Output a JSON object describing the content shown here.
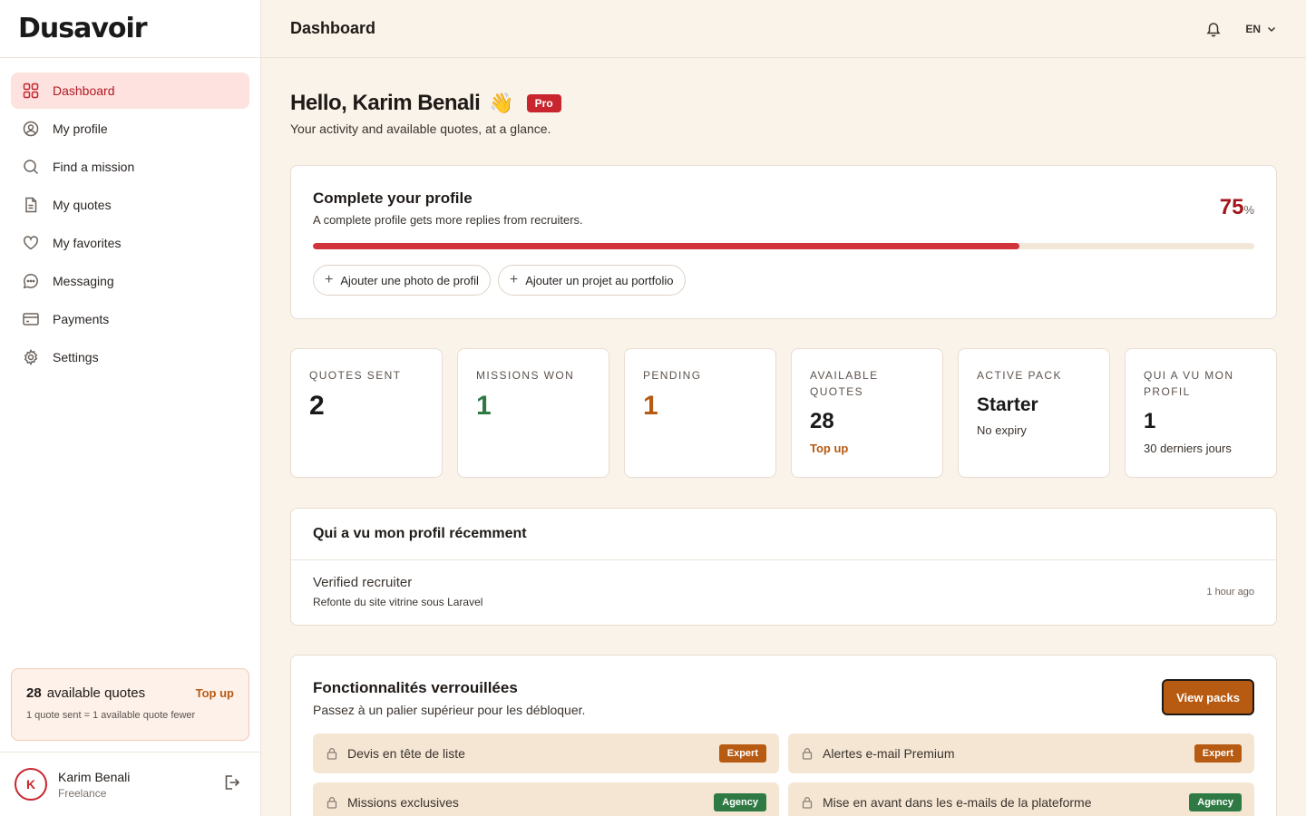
{
  "brand": {
    "logo": "Dusavoir"
  },
  "sidebar": {
    "items": [
      {
        "label": "Dashboard",
        "icon": "grid-icon",
        "active": true
      },
      {
        "label": "My profile",
        "icon": "user-circle-icon"
      },
      {
        "label": "Find a mission",
        "icon": "search-icon"
      },
      {
        "label": "My quotes",
        "icon": "document-icon"
      },
      {
        "label": "My favorites",
        "icon": "heart-icon"
      },
      {
        "label": "Messaging",
        "icon": "chat-icon"
      },
      {
        "label": "Payments",
        "icon": "card-icon"
      },
      {
        "label": "Settings",
        "icon": "gear-icon"
      }
    ],
    "quota": {
      "count": "28",
      "label": "available quotes",
      "topup": "Top up",
      "note": "1 quote sent = 1 available quote fewer"
    },
    "user": {
      "initial": "K",
      "name": "Karim Benali",
      "role": "Freelance"
    }
  },
  "header": {
    "title": "Dashboard",
    "lang": "EN"
  },
  "greeting": {
    "title": "Hello, Karim Benali",
    "emoji": "👋",
    "badge": "Pro",
    "subtitle": "Your activity and available quotes, at a glance."
  },
  "profile_completion": {
    "title": "Complete your profile",
    "subtitle": "A complete profile gets more replies from recruiters.",
    "percent": "75",
    "percent_sign": "%",
    "progress": 0.75,
    "actions": [
      "Ajouter une photo de profil",
      "Ajouter un projet au portfolio"
    ]
  },
  "stats": [
    {
      "label": "QUOTES SENT",
      "value": "2",
      "color": "default"
    },
    {
      "label": "MISSIONS WON",
      "value": "1",
      "color": "green"
    },
    {
      "label": "PENDING",
      "value": "1",
      "color": "orange"
    },
    {
      "label": "AVAILABLE QUOTES",
      "value": "28",
      "extra": "Top up",
      "extra_link": true
    },
    {
      "label": "ACTIVE PACK",
      "value": "Starter",
      "extra": "No expiry",
      "text": true
    },
    {
      "label": "QUI A VU MON PROFIL",
      "value": "1",
      "extra": "30 derniers jours"
    }
  ],
  "viewers": {
    "title": "Qui a vu mon profil récemment",
    "rows": [
      {
        "name": "Verified recruiter",
        "project": "Refonte du site vitrine sous Laravel",
        "time": "1 hour ago"
      }
    ]
  },
  "locked": {
    "title": "Fonctionnalités verrouillées",
    "subtitle": "Passez à un palier supérieur pour les débloquer.",
    "button": "View packs",
    "items": [
      {
        "label": "Devis en tête de liste",
        "tag": "Expert"
      },
      {
        "label": "Alertes e-mail Premium",
        "tag": "Expert"
      },
      {
        "label": "Missions exclusives",
        "tag": "Agency"
      },
      {
        "label": "Mise en avant dans les e-mails de la plateforme",
        "tag": "Agency"
      }
    ]
  },
  "colors": {
    "accent": "#c9252f",
    "orange": "#b75a12",
    "green": "#2f7a44",
    "background": "#faf3ea"
  }
}
